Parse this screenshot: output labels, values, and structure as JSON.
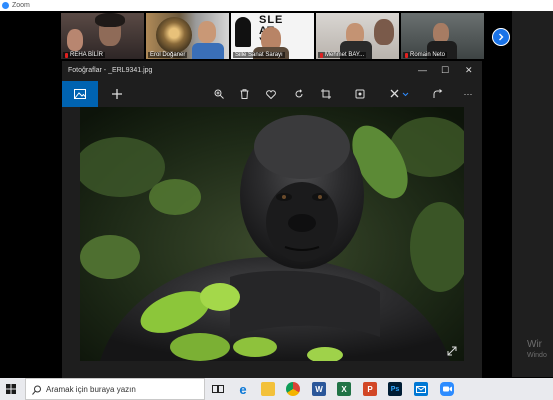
{
  "zoom": {
    "title": "Zoom"
  },
  "participants": [
    {
      "name": "REHA BİLİR",
      "muted": true
    },
    {
      "name": "Erol Doğaner",
      "muted": true
    },
    {
      "name": "Sille Sanat Sarayı",
      "muted": false
    },
    {
      "name": "Mehmet BAY...",
      "muted": true
    },
    {
      "name": "Romain Neto",
      "muted": true
    }
  ],
  "strip": {
    "next_icon": "chevron-right-icon"
  },
  "photos": {
    "title": "Fotoğraflar - _ERL9341.jpg",
    "window_controls": {
      "minimize": "—",
      "maximize": "☐",
      "close": "✕"
    },
    "toolbar": {
      "view_icon": "image-icon",
      "add_icon": "plus-icon",
      "zoom_icon": "zoom-in-icon",
      "delete_icon": "trash-icon",
      "favorite_icon": "heart-icon",
      "rotate_icon": "rotate-icon",
      "crop_icon": "crop-icon",
      "enhance_icon": "enhance-icon",
      "edit_icon": "edit-icon",
      "share_icon": "share-icon",
      "more_label": "···"
    }
  },
  "watermark": {
    "line1": "Wir",
    "line2": "Windo"
  },
  "taskbar": {
    "search_placeholder": "Aramak için buraya yazın",
    "apps": [
      "task-view-icon",
      "edge-icon",
      "file-explorer-icon",
      "chrome-icon",
      "word-icon",
      "excel-icon",
      "powerpoint-icon",
      "photoshop-icon",
      "mail-icon",
      "zoom-icon"
    ],
    "word_label": "W",
    "excel_label": "X",
    "ppt_label": "P",
    "ps_label": "Ps"
  }
}
